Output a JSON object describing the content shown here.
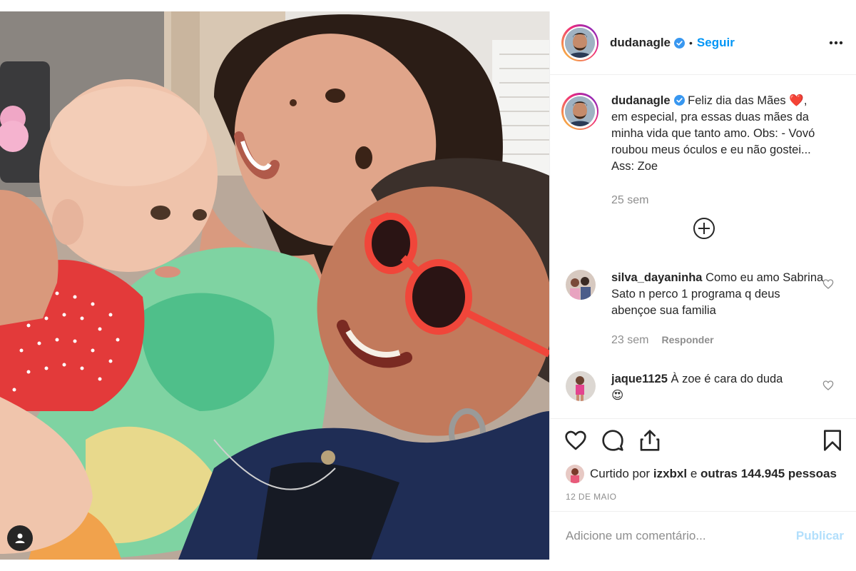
{
  "post": {
    "username": "dudanagle",
    "verified": true,
    "separator": "•",
    "follow_label": "Seguir",
    "more_icon": "more-horizontal-icon"
  },
  "caption": {
    "username": "dudanagle",
    "text_before_emoji": "Feliz dia das Mães",
    "emoji": "❤️",
    "text_after_emoji": ", em especial, pra essas duas mães da minha vida que tanto amo. Obs: - Vovó roubou meus óculos e eu não gostei... Ass: Zoe",
    "time": "25 sem"
  },
  "comments": [
    {
      "username": "silva_dayaninha",
      "text": "Como eu amo Sabrina Sato n perco 1 programa q deus abençoe sua familia",
      "time": "23 sem",
      "reply_label": "Responder"
    },
    {
      "username": "jaque1125",
      "text": "À zoe é cara do duda",
      "emoji": "😍"
    }
  ],
  "likes": {
    "prefix": "Curtido por",
    "user": "izxbxl",
    "middle": "e",
    "others": "outras 144.945 pessoas"
  },
  "date": "12 DE MAIO",
  "add_comment": {
    "placeholder": "Adicione um comentário...",
    "publish_label": "Publicar"
  },
  "colors": {
    "link_blue": "#0095f6",
    "publish_disabled": "#b2dffc",
    "muted_text": "#8e8e8e",
    "verified_blue": "#3897f0"
  }
}
